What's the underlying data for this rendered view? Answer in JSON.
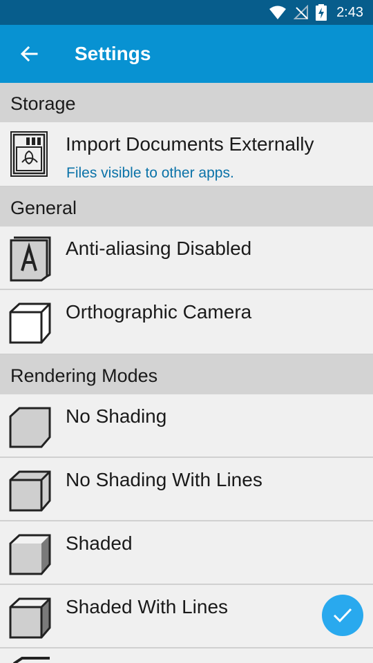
{
  "status_bar": {
    "time": "2:43"
  },
  "app_bar": {
    "title": "Settings"
  },
  "sections": {
    "storage": {
      "header": "Storage",
      "import": {
        "label": "Import Documents Externally",
        "subtitle": "Files visible to other apps."
      }
    },
    "general": {
      "header": "General",
      "antialiasing": {
        "label": "Anti-aliasing Disabled"
      },
      "camera": {
        "label": "Orthographic Camera"
      }
    },
    "rendering": {
      "header": "Rendering Modes",
      "no_shading": {
        "label": "No Shading"
      },
      "no_shading_lines": {
        "label": "No Shading With Lines"
      },
      "shaded": {
        "label": "Shaded"
      },
      "shaded_lines": {
        "label": "Shaded With Lines",
        "selected": true
      }
    }
  },
  "icons": {
    "wifi": "wifi-icon",
    "signal": "no-signal-icon",
    "battery": "battery-charging-icon",
    "back": "arrow-left-icon",
    "check": "check-icon"
  },
  "colors": {
    "status_bar": "#075d8c",
    "app_bar": "#0892d2",
    "accent": "#29a9ee",
    "subtitle": "#0a72a8"
  }
}
